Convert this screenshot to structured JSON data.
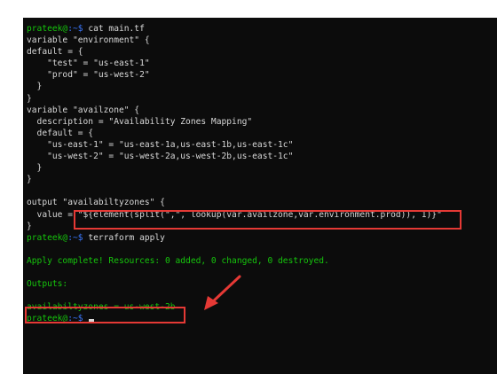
{
  "terminal": {
    "prompt_user": "prateek@",
    "prompt_path": ":~$",
    "commands": {
      "cat": " cat main.tf",
      "apply": " terraform apply"
    },
    "lines": {
      "l2": "variable \"environment\" {",
      "l3": "default = {",
      "l4": "    \"test\" = \"us-east-1\"",
      "l5": "    \"prod\" = \"us-west-2\"",
      "l6": "  }",
      "l7": "}",
      "l8": "variable \"availzone\" {",
      "l9": "  description = \"Availability Zones Mapping\"",
      "l10": "  default = {",
      "l11": "    \"us-east-1\" = \"us-east-1a,us-east-1b,us-east-1c\"",
      "l12": "    \"us-west-2\" = \"us-west-2a,us-west-2b,us-east-1c\"",
      "l13": "  }",
      "l14": "}",
      "l16": "output \"availabiltyzones\" {",
      "l17": "  value = \"${element(split(\",\", lookup(var.availzone,var.environment.prod)), 1)}\"",
      "l18": "}"
    },
    "apply_complete": "Apply complete! Resources: 0 added, 0 changed, 0 destroyed.",
    "outputs_label": "Outputs:",
    "output_line": "availabiltyzones = us-west-2b"
  },
  "colors": {
    "background": "#0c0c0c",
    "text": "#d8d8d8",
    "prompt_user": "#16c60c",
    "prompt_path": "#3b78ff",
    "success": "#16c60c",
    "annotation": "#e53935"
  },
  "icons": {
    "annotation_arrow": "red-arrow-icon"
  }
}
